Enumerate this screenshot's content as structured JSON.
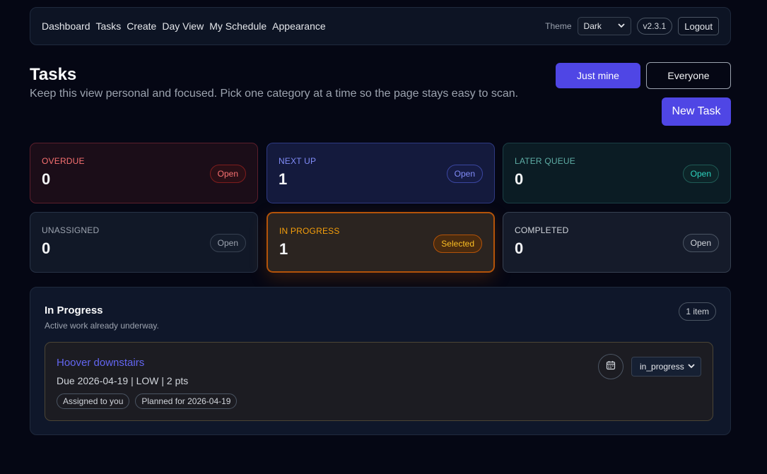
{
  "nav": {
    "links": [
      "Dashboard",
      "Tasks",
      "Create",
      "Day View",
      "My Schedule",
      "Appearance"
    ],
    "theme_label": "Theme",
    "theme_value": "Dark",
    "version": "v2.3.1",
    "logout": "Logout"
  },
  "header": {
    "title": "Tasks",
    "subtitle": "Keep this view personal and focused. Pick one category at a time so the page stays easy to scan.",
    "just_mine": "Just mine",
    "everyone": "Everyone",
    "new_task": "New Task"
  },
  "cards": [
    {
      "label": "OVERDUE",
      "count": "0",
      "badge": "Open"
    },
    {
      "label": "NEXT UP",
      "count": "1",
      "badge": "Open"
    },
    {
      "label": "LATER QUEUE",
      "count": "0",
      "badge": "Open"
    },
    {
      "label": "UNASSIGNED",
      "count": "0",
      "badge": "Open"
    },
    {
      "label": "IN PROGRESS",
      "count": "1",
      "badge": "Selected"
    },
    {
      "label": "COMPLETED",
      "count": "0",
      "badge": "Open"
    }
  ],
  "section": {
    "title": "In Progress",
    "subtitle": "Active work already underway.",
    "count": "1 item",
    "task": {
      "title": "Hoover downstairs",
      "meta": "Due 2026-04-19 | LOW | 2 pts",
      "tags": [
        "Assigned to you",
        "Planned for 2026-04-19"
      ],
      "status": "in_progress",
      "calendar_icon": "calendar-icon"
    }
  },
  "colors": {
    "accent": "#4f46e5",
    "overdue": "#f87171",
    "next": "#818cf8",
    "later": "#2dd4bf",
    "in_progress": "#f59e0b",
    "background": "#050714"
  }
}
